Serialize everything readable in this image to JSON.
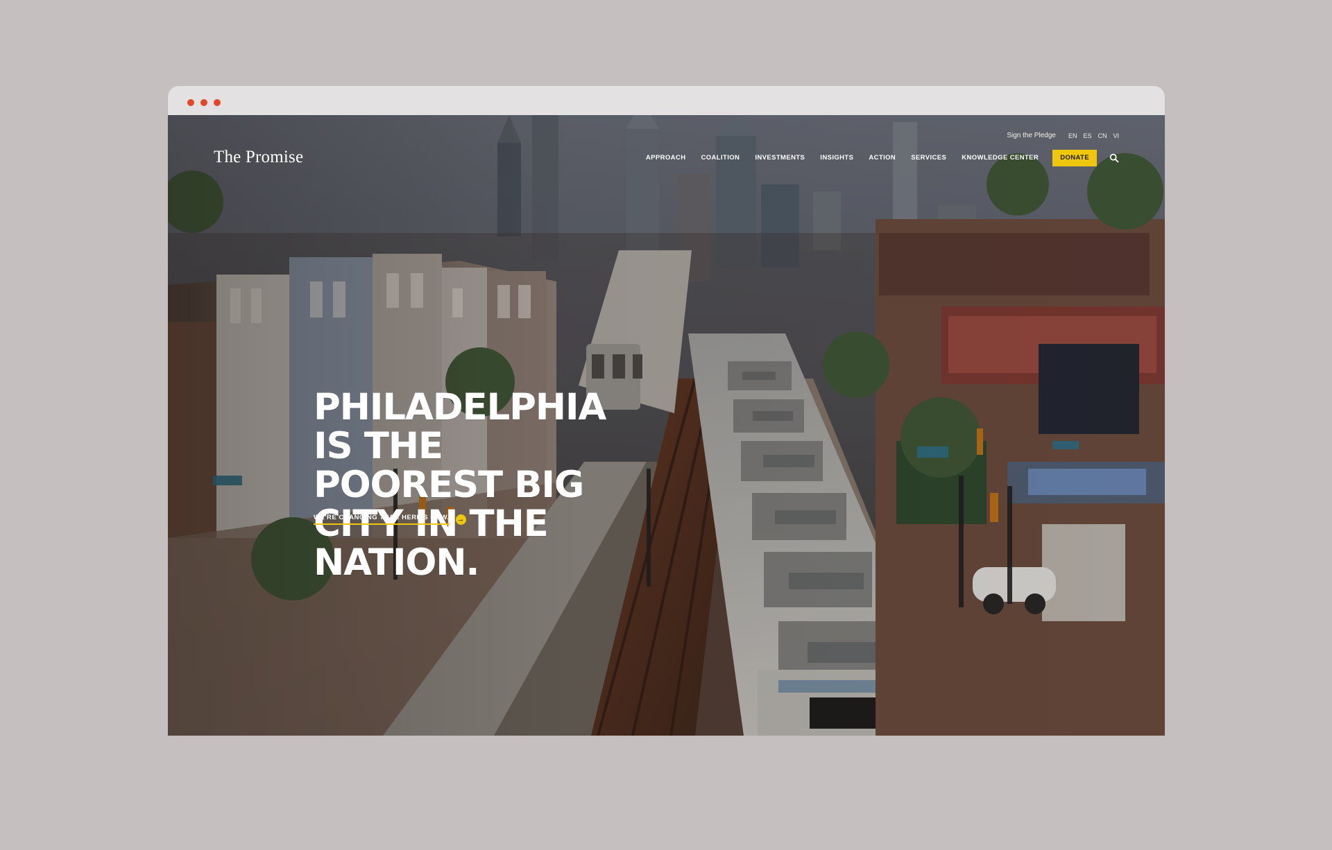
{
  "site": {
    "logo_text": "The Promise"
  },
  "utility": {
    "pledge_label": "Sign the Pledge",
    "languages": [
      "EN",
      "ES",
      "CN",
      "VI"
    ]
  },
  "nav": {
    "items": [
      {
        "label": "APPROACH"
      },
      {
        "label": "COALITION"
      },
      {
        "label": "INVESTMENTS"
      },
      {
        "label": "INSIGHTS"
      },
      {
        "label": "ACTION"
      },
      {
        "label": "SERVICES"
      },
      {
        "label": "KNOWLEDGE CENTER"
      }
    ],
    "donate_label": "DONATE",
    "search_icon": "search-icon"
  },
  "hero": {
    "headline": "PHILADELPHIA IS THE POOREST BIG CITY IN THE NATION.",
    "cta_label": "WE'RE CHANGING THAT. HERE'S HOW."
  },
  "colors": {
    "accent": "#f1c60f",
    "browser_dots": "#e2472a",
    "page_background": "#c6bfbf"
  }
}
